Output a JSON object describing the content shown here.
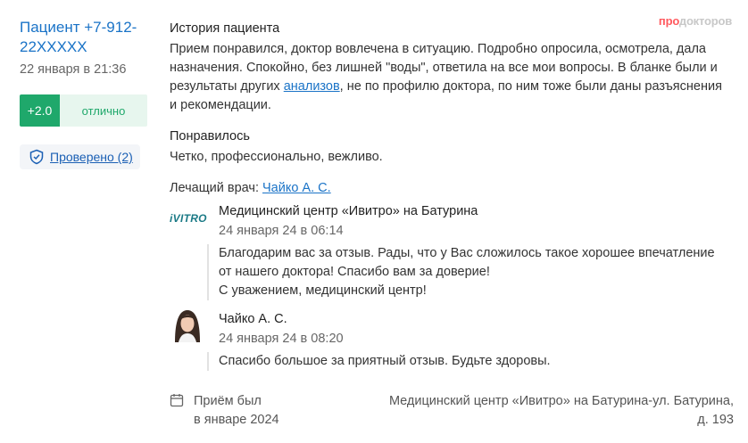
{
  "review": {
    "author": "Пациент +7-912-22XXXXX",
    "date": "22 января в 21:36",
    "rating": {
      "score": "+2.0",
      "label": "отлично"
    },
    "verified_label": "Проверено (2)"
  },
  "brand": {
    "logo_part1": "про",
    "logo_part2": "докторов"
  },
  "history": {
    "title": "История пациента",
    "text_before_link": "Прием понравился, доктор вовлечена в ситуацию. Подробно опросила, осмотрела, дала назначения. Спокойно, без лишней \"воды\", ответила на все мои вопросы. В бланке были и результаты других ",
    "link": "анализов",
    "text_after_link": ", не по профилю доктора, по ним тоже были даны разъяснения и рекомендации."
  },
  "liked": {
    "title": "Понравилось",
    "text": "Четко, профессионально, вежливо."
  },
  "doctor": {
    "label": "Лечащий врач: ",
    "name": "Чайко А. С."
  },
  "replies": [
    {
      "logo": "iVITRO",
      "author": "Медицинский центр «Ивитро» на Батурина",
      "date": "24 января 24 в 06:14",
      "lines": [
        "Благодарим вас за отзыв. Рады, что у Вас сложилось такое хорошее впечатление",
        "от нашего доктора! Спасибо вам за доверие!",
        "С уважением, медицинский центр!"
      ]
    },
    {
      "author": "Чайко А. С.",
      "date": "24 января 24 в 08:20",
      "lines": [
        "Спасибо большое за приятный отзыв. Будьте здоровы."
      ]
    }
  ],
  "footer": {
    "visit_line1": "Приём был",
    "visit_line2": "в январе 2024",
    "place_line1": "Медицинский центр «Ивитро» на Батурина-ул. Батурина,",
    "place_line2": "д. 193"
  },
  "colors": {
    "accent": "#1a73c7",
    "rating_green": "#1fa86b",
    "rating_bg": "#e7f6ee",
    "brand_red": "#ff5a5f"
  },
  "icons": [
    "shield-check-icon",
    "calendar-icon",
    "ivitro-logo",
    "doctor-avatar"
  ]
}
